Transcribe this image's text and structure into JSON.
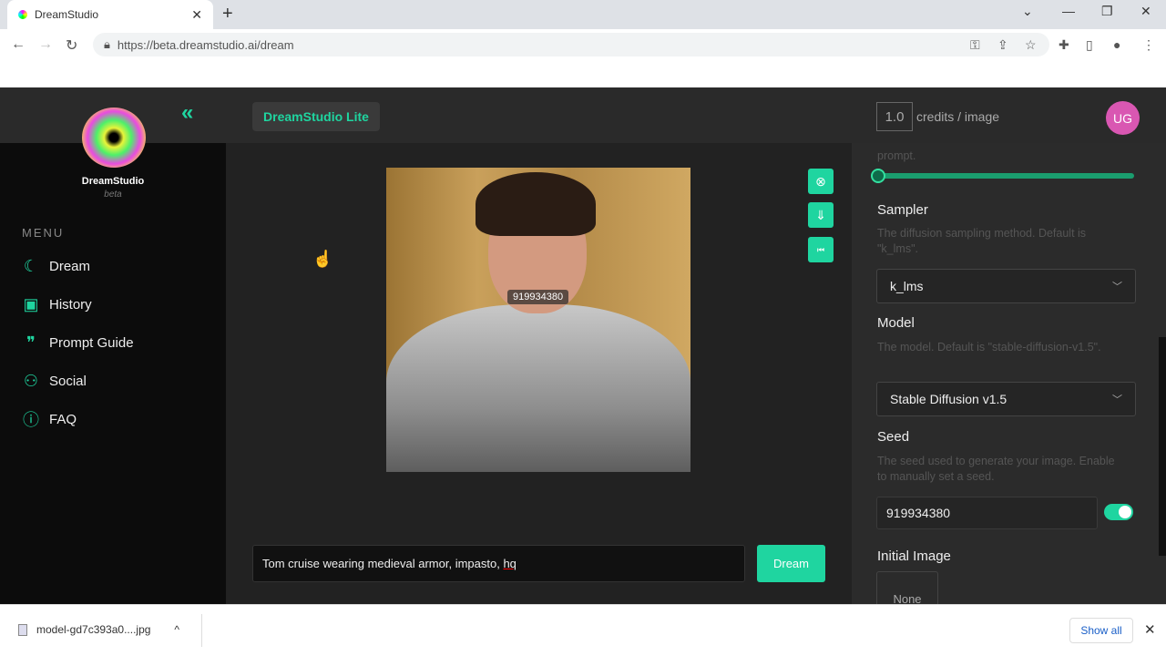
{
  "browser": {
    "tab_title": "DreamStudio",
    "url": "https://beta.dreamstudio.ai/dream"
  },
  "header": {
    "badge": "DreamStudio Lite",
    "credits_value": "1.0",
    "credits_label": "credits / image",
    "avatar_initials": "UG"
  },
  "sidebar": {
    "brand": "DreamStudio",
    "subtitle": "beta",
    "menu_label": "MENU",
    "items": [
      {
        "label": "Dream",
        "icon": "moon-sparkle-icon"
      },
      {
        "label": "History",
        "icon": "images-icon"
      },
      {
        "label": "Prompt Guide",
        "icon": "quote-bubble-icon"
      },
      {
        "label": "Social",
        "icon": "users-icon"
      },
      {
        "label": "FAQ",
        "icon": "question-circle-icon"
      }
    ]
  },
  "main": {
    "image_seed_overlay": "919934380",
    "prompt": "Tom cruise wearing medieval armor, impasto, ",
    "prompt_misspelled": "hq",
    "dream_button": "Dream"
  },
  "settings": {
    "prompt_strength_desc_tail": "prompt.",
    "prompt_strength_slider": 0,
    "sampler": {
      "title": "Sampler",
      "desc": "The diffusion sampling method. Default is \"k_lms\".",
      "value": "k_lms"
    },
    "model": {
      "title": "Model",
      "desc": "The model. Default is \"stable-diffusion-v1.5\".",
      "value": "Stable Diffusion v1.5"
    },
    "seed": {
      "title": "Seed",
      "desc": "The seed used to generate your image. Enable to manually set a seed.",
      "value": "919934380",
      "enabled": true
    },
    "initial_image": {
      "title": "Initial Image",
      "value": "None"
    }
  },
  "downloads": {
    "file": "model-gd7c393a0....jpg",
    "show_all": "Show all"
  },
  "colors": {
    "accent": "#1fd5a0",
    "avatar": "#d957b2"
  }
}
